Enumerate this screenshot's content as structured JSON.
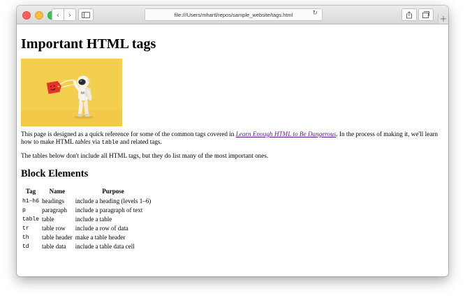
{
  "browser": {
    "url": "file:///Users/mhartl/repos/sample_website/tags.html",
    "back_icon": "chevron-left-icon",
    "forward_icon": "chevron-right-icon",
    "reload_icon": "reload-icon",
    "new_tab_label": "+"
  },
  "page": {
    "title": "Important HTML tags",
    "intro": {
      "before_link": "This page is designed as a quick reference for some of the common tags covered in ",
      "link_text": "Learn Enough HTML to Be Dangerous",
      "after_link": ". In the process of making it, we'll learn how to make HTML ",
      "em_word": "tables",
      "via_text": " via ",
      "code_word": "table",
      "end_text": " and related tags."
    },
    "note": "The tables below don't include all HTML tags, but they do list many of the most important ones.",
    "section_title": "Block Elements",
    "table": {
      "headers": [
        "Tag",
        "Name",
        "Purpose"
      ],
      "rows": [
        {
          "tag": "h1–h6",
          "name": "headings",
          "purpose": "include a heading (levels 1–6)"
        },
        {
          "tag": "p",
          "name": "paragraph",
          "purpose": "include a paragraph of text"
        },
        {
          "tag": "table",
          "name": "table",
          "purpose": "include a table"
        },
        {
          "tag": "tr",
          "name": "table row",
          "purpose": "include a row of data"
        },
        {
          "tag": "th",
          "name": "table header",
          "purpose": "make a table header"
        },
        {
          "tag": "td",
          "name": "table data",
          "purpose": "include a table data cell"
        }
      ]
    }
  },
  "colors": {
    "hero_bg": "#f4cf4f",
    "tag_red": "#e8302b",
    "link": "#551a8b"
  }
}
